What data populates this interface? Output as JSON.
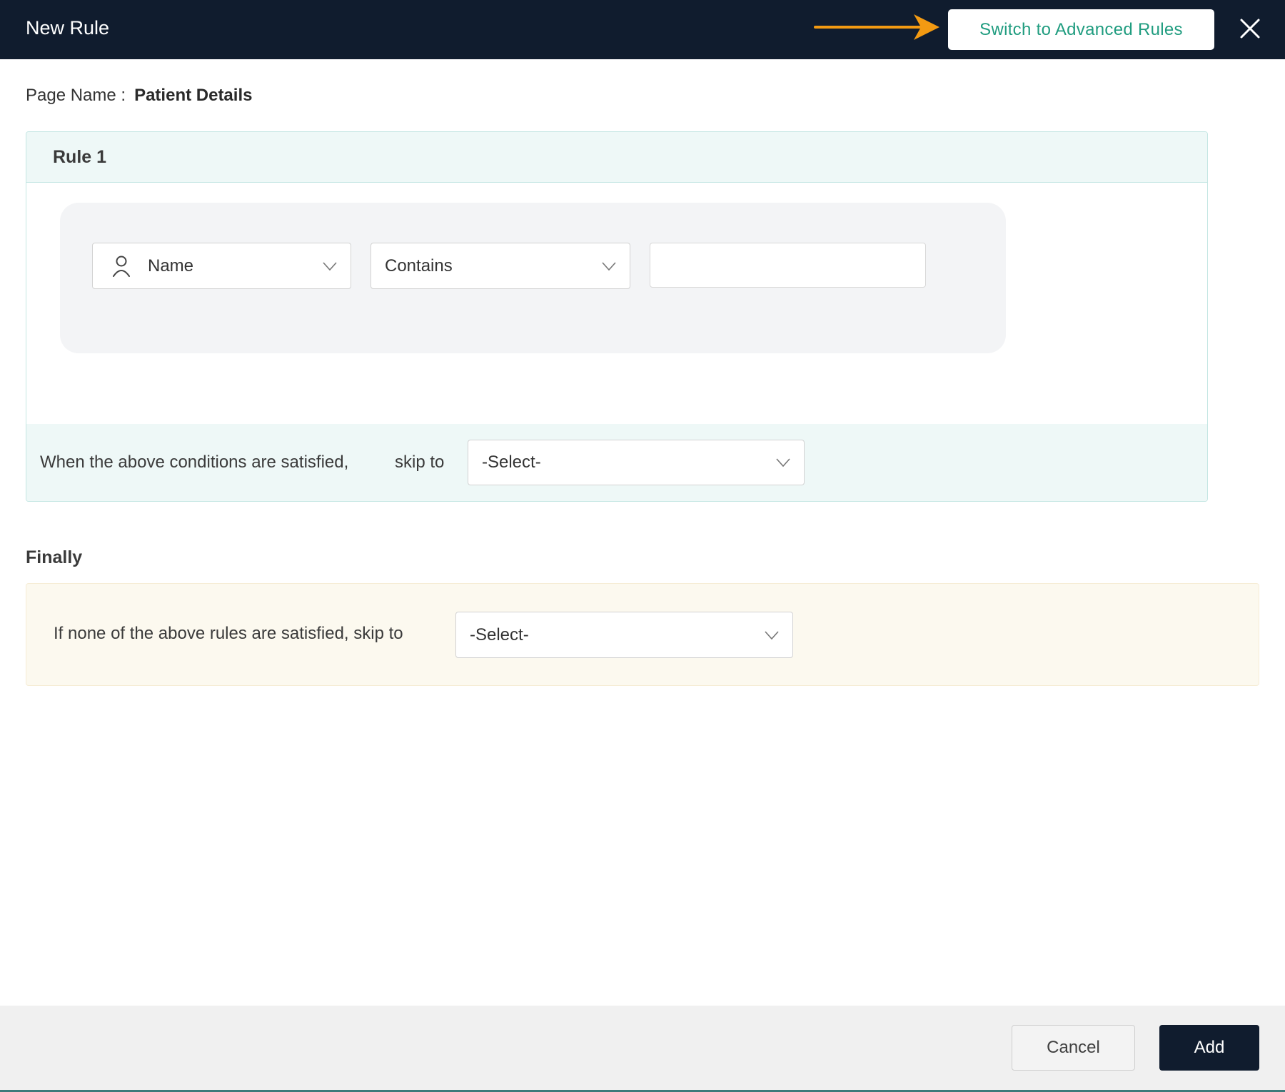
{
  "header": {
    "title": "New Rule",
    "advanced_button_label": "Switch to Advanced Rules",
    "close_icon": "close-icon",
    "annotation_arrow_color": "#f39a12"
  },
  "page": {
    "name_label": "Page Name :",
    "name_value": "Patient Details"
  },
  "rule": {
    "title": "Rule 1",
    "condition": {
      "field": {
        "icon": "user-icon",
        "value": "Name"
      },
      "operator": {
        "value": "Contains"
      },
      "value_input": {
        "value": "",
        "placeholder": ""
      }
    },
    "skip_text": "When the above conditions are satisfied,",
    "skip_to_label": "skip to",
    "skip_select": {
      "value": "-Select-"
    }
  },
  "finally": {
    "title": "Finally",
    "text": "If none of the above rules are satisfied, skip to",
    "select": {
      "value": "-Select-"
    }
  },
  "footer": {
    "cancel_label": "Cancel",
    "add_label": "Add"
  },
  "colors": {
    "header_bg": "#101c2e",
    "accent_text": "#1f9c7f",
    "rule_bg": "#eef8f7",
    "finally_bg": "#fcf9ef"
  }
}
